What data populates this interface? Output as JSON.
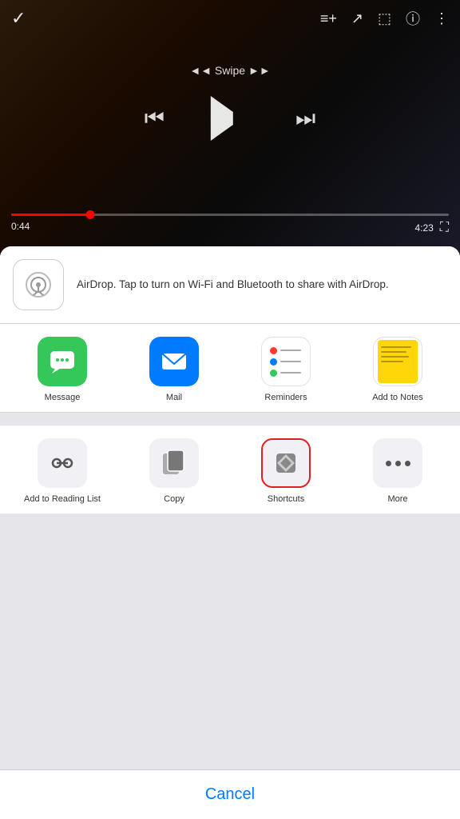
{
  "video": {
    "swipe_label": "◄◄  Swipe  ►►",
    "time_current": "0:44",
    "time_total": "4:23",
    "progress_percent": 18
  },
  "airdrop": {
    "label": "AirDrop",
    "description": "AirDrop. Tap to turn on Wi-Fi and Bluetooth to share with AirDrop."
  },
  "apps": [
    {
      "id": "message",
      "label": "Message"
    },
    {
      "id": "mail",
      "label": "Mail"
    },
    {
      "id": "reminders",
      "label": "Reminders"
    },
    {
      "id": "add-to-notes",
      "label": "Add to Notes"
    }
  ],
  "actions": [
    {
      "id": "reading-list",
      "label": "Add to Reading List",
      "highlighted": false
    },
    {
      "id": "copy",
      "label": "Copy",
      "highlighted": false
    },
    {
      "id": "shortcuts",
      "label": "Shortcuts",
      "highlighted": true
    },
    {
      "id": "more",
      "label": "More",
      "highlighted": false
    }
  ],
  "cancel": {
    "label": "Cancel"
  },
  "icons": {
    "chevron_down": "∨",
    "add_to_queue": "≡+",
    "share": "↗",
    "cast": "⬜",
    "info": "ⓘ",
    "more_vert": "⋮",
    "skip_prev": "⏮",
    "skip_next": "⏭",
    "fullscreen": "⛶"
  }
}
